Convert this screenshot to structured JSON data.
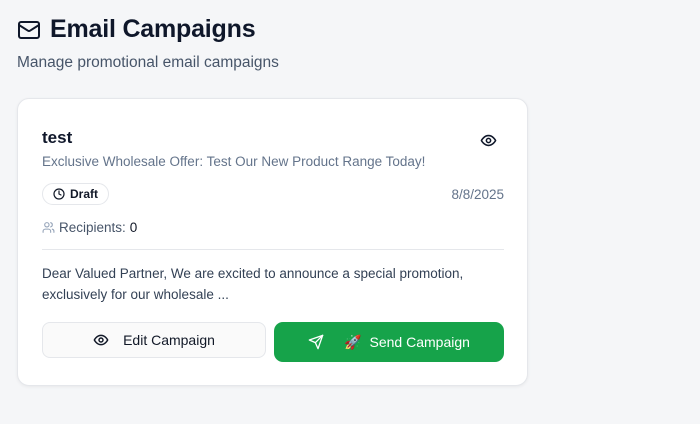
{
  "header": {
    "icon": "mail-icon",
    "title": "Email Campaigns",
    "subtitle": "Manage promotional email campaigns"
  },
  "campaign": {
    "name": "test",
    "subject": "Exclusive Wholesale Offer: Test Our New Product Range Today!",
    "status": "Draft",
    "status_icon": "clock-icon",
    "date": "8/8/2025",
    "recipients_label": "Recipients:",
    "recipients_count": "0",
    "preview": "Dear Valued Partner, We are excited to announce a special promotion, exclusively for our wholesale ...",
    "edit_label": "Edit Campaign",
    "send_emoji": "🚀",
    "send_label": "Send Campaign"
  },
  "colors": {
    "send_button": "#16a34a",
    "background": "#f5f6f8"
  }
}
